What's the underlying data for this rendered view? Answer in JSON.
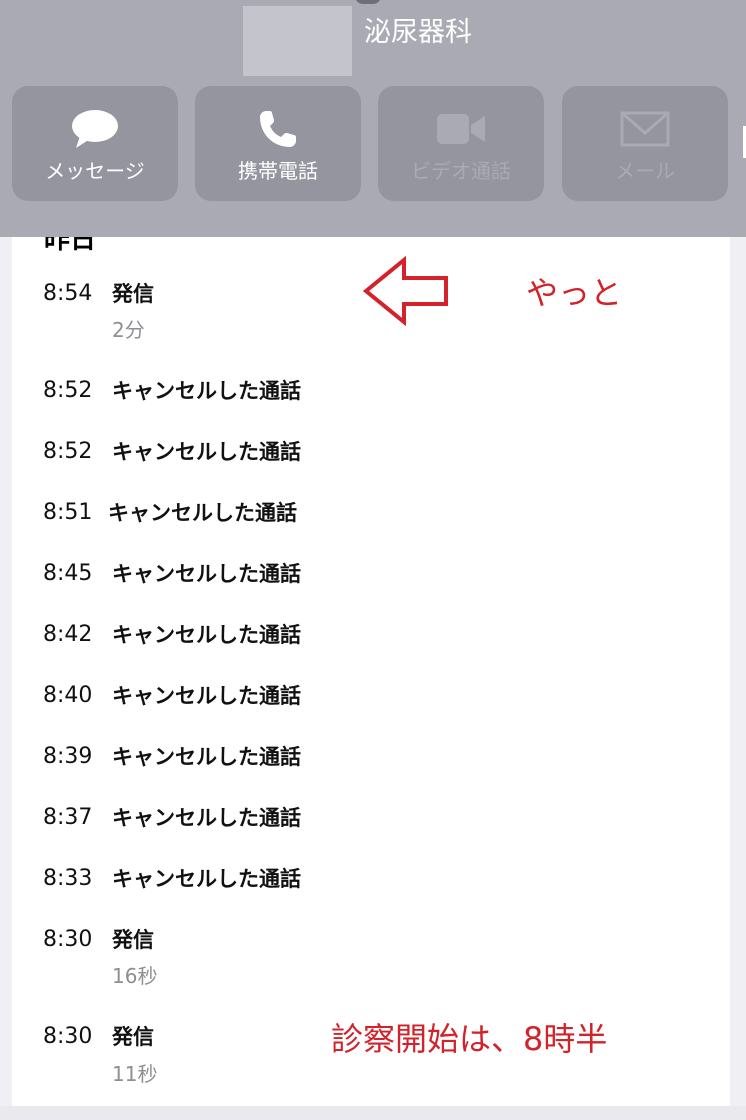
{
  "header": {
    "contact_name": "泌尿器科",
    "actions": [
      {
        "label": "メッセージ",
        "icon": "message-bubble-icon",
        "enabled": true
      },
      {
        "label": "携帯電話",
        "icon": "phone-icon",
        "enabled": true
      },
      {
        "label": "ビデオ通話",
        "icon": "video-camera-icon",
        "enabled": false
      },
      {
        "label": "メール",
        "icon": "mail-icon",
        "enabled": false
      }
    ]
  },
  "section": {
    "title": "昨日"
  },
  "calls": [
    {
      "time": "8:54",
      "label": "発信",
      "duration": "2分"
    },
    {
      "time": "8:52",
      "label": "キャンセルした通話"
    },
    {
      "time": "8:52",
      "label": "キャンセルした通話"
    },
    {
      "time": "8:51",
      "label": "キャンセルした通話"
    },
    {
      "time": "8:45",
      "label": "キャンセルした通話"
    },
    {
      "time": "8:42",
      "label": "キャンセルした通話"
    },
    {
      "time": "8:40",
      "label": "キャンセルした通話"
    },
    {
      "time": "8:39",
      "label": "キャンセルした通話"
    },
    {
      "time": "8:37",
      "label": "キャンセルした通話"
    },
    {
      "time": "8:33",
      "label": "キャンセルした通話"
    },
    {
      "time": "8:30",
      "label": "発信",
      "duration": "16秒"
    },
    {
      "time": "8:30",
      "label": "発信",
      "duration": "11秒"
    }
  ],
  "annotations": {
    "arrow_note": "やっと",
    "bottom_note": "診察開始は、8時半",
    "color": "#d3222a"
  }
}
